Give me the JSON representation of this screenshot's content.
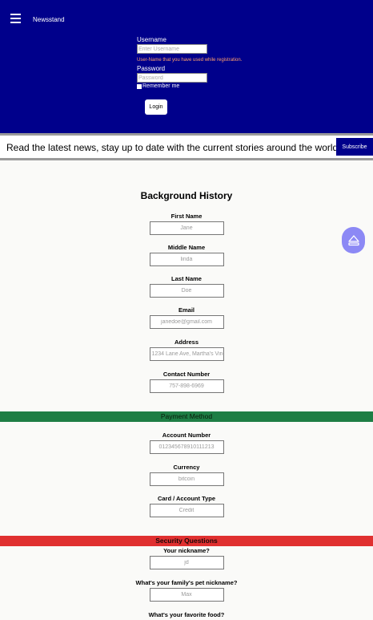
{
  "header": {
    "brand": "Newsstand",
    "login": {
      "username_label": "Username",
      "username_placeholder": "Enter Username",
      "username_hint": "User-Name that you have used while registration.",
      "password_label": "Password",
      "password_placeholder": "Password",
      "remember_label": "Remember me",
      "login_button": "Login"
    }
  },
  "subscribe": {
    "text": "Read the latest news, stay up to date with the current stories around the world",
    "button": "Subscribe"
  },
  "form": {
    "title": "Background History",
    "background": [
      {
        "label": "First Name",
        "placeholder": "Jane"
      },
      {
        "label": "Middle Name",
        "placeholder": "linda"
      },
      {
        "label": "Last Name",
        "placeholder": "Doe"
      },
      {
        "label": "Email",
        "placeholder": "janedoe@gmail.com"
      },
      {
        "label": "Address",
        "placeholder": "1234 Lane Ave, Martha's Vineyard"
      },
      {
        "label": "Contact Number",
        "placeholder": "757-898-6969"
      }
    ],
    "payment_heading": "Payment Method",
    "payment": [
      {
        "label": "Account Number",
        "placeholder": "012345678910111213"
      },
      {
        "label": "Currency",
        "placeholder": "bitcoin"
      },
      {
        "label": "Card / Account Type",
        "placeholder": "Credit"
      }
    ],
    "security_heading": "Security Questions",
    "security": [
      {
        "label": "Your nickname?",
        "placeholder": "jd"
      },
      {
        "label": "What's your family's pet nickname?",
        "placeholder": "Max"
      },
      {
        "label": "What's your favorite food?",
        "placeholder": ""
      }
    ]
  },
  "icons": {
    "menu": "hamburger-menu-icon",
    "scroll_top": "eject-up-icon"
  },
  "colors": {
    "header_bg": "#00008b",
    "payment_band": "#1e7e45",
    "security_band": "#e03030",
    "float_button": "#8c89f5",
    "hint_text": "#ff9e6b"
  }
}
